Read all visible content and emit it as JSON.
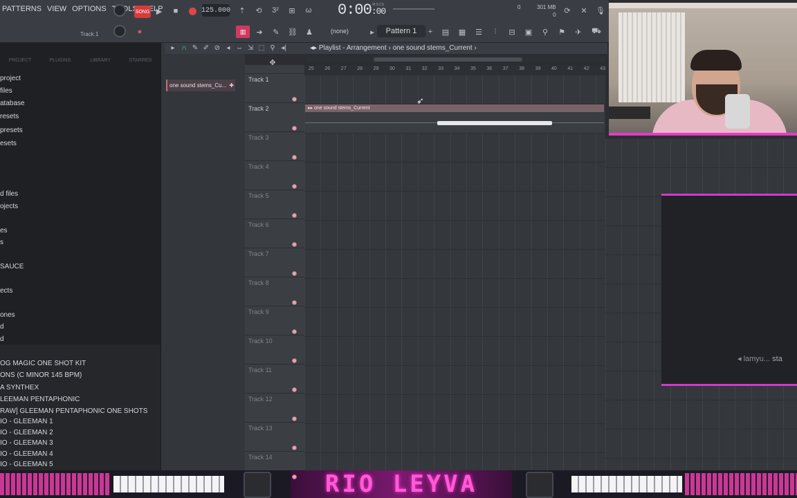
{
  "menu": {
    "items": [
      "PATTERNS",
      "VIEW",
      "OPTIONS",
      "TOOLS",
      "HELP"
    ]
  },
  "transport": {
    "mode_label": "SONG",
    "tempo": "125.000",
    "time_main": "0:00",
    "time_sub": "00",
    "time_format": "M:S:CS",
    "memory": "301 MB",
    "mem_zero_a": "0",
    "mem_zero_b": "0"
  },
  "channel": {
    "current_track_label": "Track 1"
  },
  "pattern": {
    "none_label": "(none)",
    "current": "Pattern 1"
  },
  "browser": {
    "tabs": [
      "PROJECT",
      "PLUGINS",
      "LIBRARY",
      "STARRED"
    ],
    "items": [
      "project",
      "files",
      "atabase",
      "resets",
      "presets",
      "esets",
      "d files",
      "ojects",
      "es",
      "s",
      "SAUCE",
      "ects",
      "ones",
      "d",
      "d"
    ],
    "lower_items": [
      "OG MAGIC ONE SHOT KIT",
      "ONS (C MINOR 145 BPM)",
      "A SYNTHEX",
      "LEEMAN PENTAPHONIC",
      "RAW] GLEEMAN PENTAPHONIC ONE SHOTS",
      "IO - GLEEMAN 1",
      "IO - GLEEMAN 2",
      "IO - GLEEMAN 3",
      "IO - GLEEMAN 4",
      "IO - GLEEMAN 5"
    ]
  },
  "picker": {
    "item": "one sound stems_Cu..."
  },
  "playlist": {
    "title": "Playlist - Arrangement",
    "separator": "›",
    "clip_path": "one sound stems_Current",
    "timeline_ticks": [
      "25",
      "26",
      "27",
      "28",
      "29",
      "30",
      "31",
      "32",
      "33",
      "34",
      "35",
      "36",
      "37",
      "38",
      "39",
      "40",
      "41",
      "42",
      "43"
    ],
    "tracks": [
      "Track 1",
      "Track 2",
      "Track 3",
      "Track 4",
      "Track 5",
      "Track 6",
      "Track 7",
      "Track 8",
      "Track 9",
      "Track 10",
      "Track 11",
      "Track 12",
      "Track 13",
      "Track 14"
    ],
    "clip_label": "one sound stems_Current"
  },
  "chat": {
    "user": "lamyu...",
    "trail": "sta"
  },
  "overlay": {
    "brand": "RIO LEYVA",
    "accent_color": "#ff5ad6"
  }
}
